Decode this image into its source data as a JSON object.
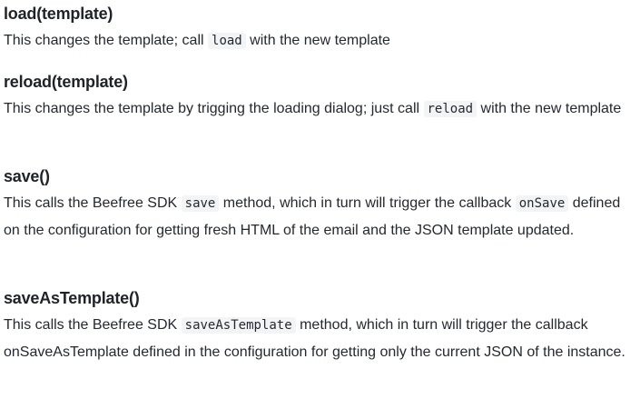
{
  "methods": {
    "load": {
      "title": "load(template)",
      "desc_1": "This changes the template; call ",
      "code_1": "load",
      "desc_2": " with the new template"
    },
    "reload": {
      "title": "reload(template)",
      "desc_1": "This changes the template by trigging the loading dialog; just call ",
      "code_1": "reload",
      "desc_2": " with the new template"
    },
    "save": {
      "title": "save()",
      "desc_1": "This calls the Beefree SDK ",
      "code_1": "save",
      "desc_2": " method, which in turn will trigger the callback ",
      "code_2": "onSave",
      "desc_3": " defined on the configuration for getting fresh HTML of the email and the JSON template updated."
    },
    "saveAsTemplate": {
      "title": "saveAsTemplate()",
      "desc_1": "This calls the Beefree SDK ",
      "code_1": "saveAsTemplate",
      "desc_2": " method, which in turn will trigger the callback onSaveAsTemplate defined in the configuration for getting only the current JSON of the instance."
    }
  },
  "colors": {
    "text": "#24292f",
    "code_bg": "#f3f4f6"
  }
}
